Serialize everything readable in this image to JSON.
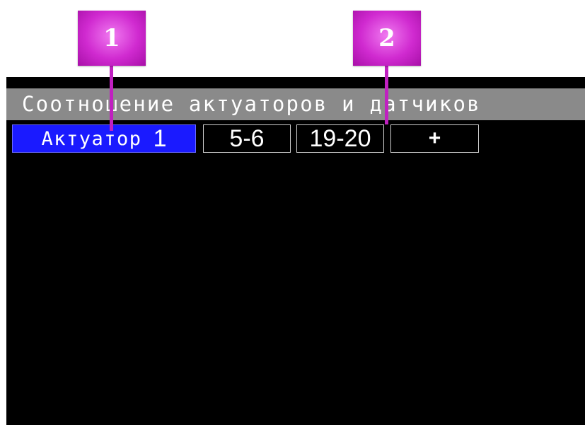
{
  "header": {
    "title": "Соотношение актуаторов и датчиков"
  },
  "row": {
    "actuator_label": "Актуатор",
    "actuator_number": "1",
    "range_1": "5-6",
    "range_2": "19-20",
    "add_label": "+"
  },
  "callouts": [
    {
      "label": "1"
    },
    {
      "label": "2"
    }
  ],
  "colors": {
    "screen_background": "#000000",
    "header_background": "#8a8a8a",
    "selected_cell": "#1a1aff",
    "callout": "#c020c0",
    "text": "#ffffff"
  }
}
